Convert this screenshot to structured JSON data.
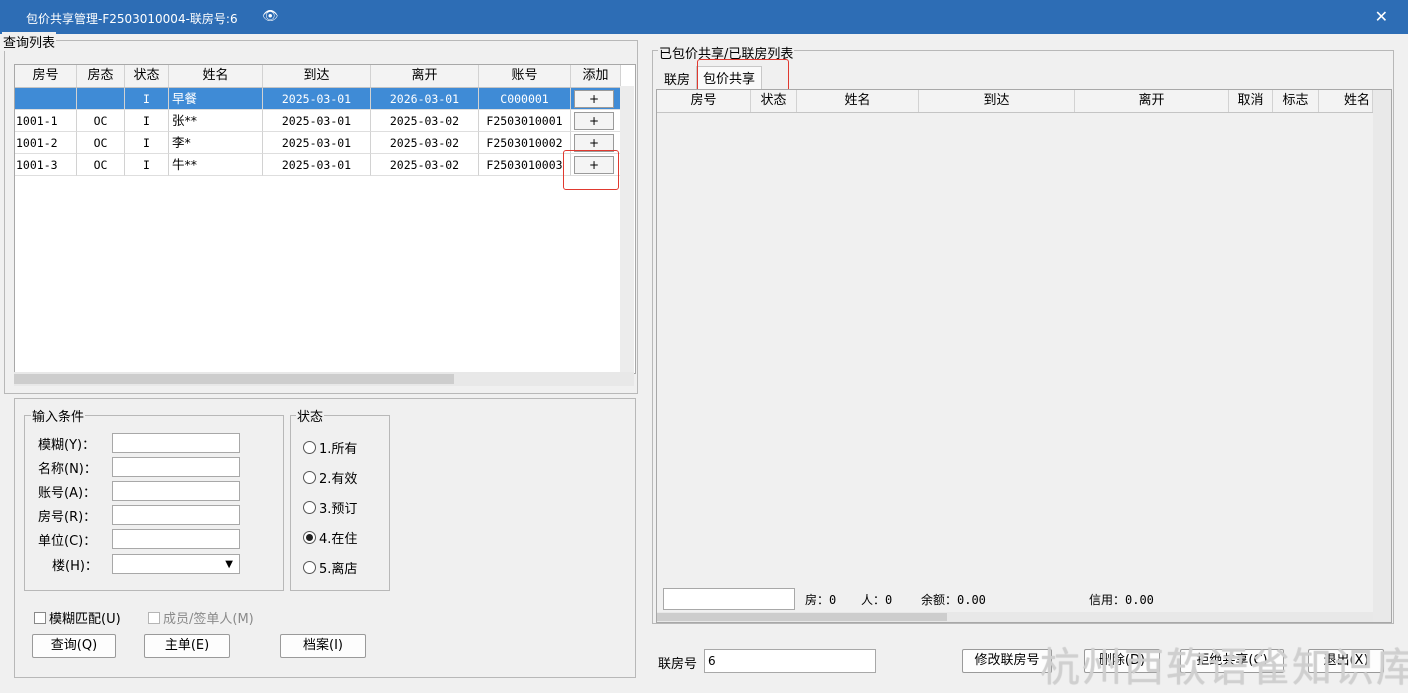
{
  "window": {
    "title": "包价共享管理-F2503010004-联房号:6",
    "eye_icon": "eye-icon",
    "close_icon": "close-icon",
    "close_glyph": "✕",
    "eye_glyph": "👁"
  },
  "left": {
    "group_title": "查询列表",
    "columns": [
      "房号",
      "房态",
      "状态",
      "姓名",
      "到达",
      "离开",
      "账号",
      "添加"
    ],
    "rows": [
      {
        "room": "",
        "room_status": "",
        "status": "I",
        "name": "早餐",
        "arrive": "2025-03-01",
        "depart": "2026-03-01",
        "account": "C000001",
        "add": "+",
        "selected": true
      },
      {
        "room": "1001-1",
        "room_status": "OC",
        "status": "I",
        "name": "张**",
        "arrive": "2025-03-01",
        "depart": "2025-03-02",
        "account": "F2503010001",
        "add": "+",
        "selected": false
      },
      {
        "room": "1001-2",
        "room_status": "OC",
        "status": "I",
        "name": "李*",
        "arrive": "2025-03-01",
        "depart": "2025-03-02",
        "account": "F2503010002",
        "add": "+",
        "selected": false
      },
      {
        "room": "1001-3",
        "room_status": "OC",
        "status": "I",
        "name": "牛**",
        "arrive": "2025-03-01",
        "depart": "2025-03-02",
        "account": "F2503010003",
        "add": "+",
        "selected": false
      }
    ]
  },
  "conditions": {
    "group_title": "输入条件",
    "fields": [
      {
        "label": "模糊(Y)：",
        "value": ""
      },
      {
        "label": "名称(N)：",
        "value": ""
      },
      {
        "label": "账号(A)：",
        "value": ""
      },
      {
        "label": "房号(R)：",
        "value": ""
      },
      {
        "label": "单位(C)：",
        "value": ""
      },
      {
        "label": "楼(H)：",
        "value": ""
      }
    ],
    "combo_arrow": "▼"
  },
  "status_filter": {
    "group_title": "状态",
    "options": [
      {
        "label": "1.所有",
        "checked": false
      },
      {
        "label": "2.有效",
        "checked": false
      },
      {
        "label": "3.预订",
        "checked": false
      },
      {
        "label": "4.在住",
        "checked": true
      },
      {
        "label": "5.离店",
        "checked": false
      }
    ]
  },
  "checkboxes": {
    "fuzzy_match": "模糊匹配(U)",
    "member_signer": "成员/签单人(M)"
  },
  "buttons": {
    "query": "查询(Q)",
    "master": "主单(E)",
    "profile": "档案(I)",
    "modify_link": "修改联房号",
    "delete": "删除(D)",
    "cancel": "拒绝共享(C)",
    "exit": "退出(X)"
  },
  "right": {
    "group_title": "已包价共享/已联房列表",
    "tabs": [
      "联房",
      "包价共享"
    ],
    "active_tab": "包价共享",
    "columns": [
      "房号",
      "状态",
      "姓名",
      "到达",
      "离开",
      "取消",
      "标志",
      "姓名"
    ],
    "rows": [],
    "summary": {
      "input_value": "",
      "rooms_label": "房：0",
      "people_label": "人：0",
      "balance_label": "余额：0.00",
      "credit_label": "信用：0.00"
    }
  },
  "bottom": {
    "link_no_label": "联房号",
    "link_no_value": "6"
  },
  "watermark": "杭州西软语雀知识库"
}
